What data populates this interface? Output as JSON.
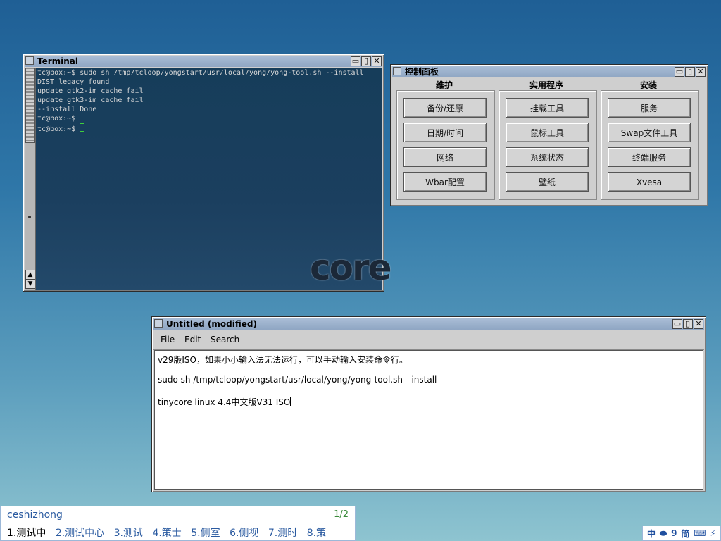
{
  "terminal": {
    "title": "Terminal",
    "lines": [
      "tc@box:~$ sudo sh /tmp/tcloop/yongstart/usr/local/yong/yong-tool.sh --install",
      "DIST legacy found",
      "update gtk2-im cache fail",
      "update gtk3-im cache fail",
      "--install Done",
      "tc@box:~$",
      "tc@box:~$ "
    ]
  },
  "cpanel": {
    "title": "控制面板",
    "columns": [
      {
        "heading": "维护",
        "buttons": [
          "备份/还原",
          "日期/时间",
          "网络",
          "Wbar配置"
        ]
      },
      {
        "heading": "实用程序",
        "buttons": [
          "挂载工具",
          "鼠标工具",
          "系统状态",
          "壁纸"
        ]
      },
      {
        "heading": "安装",
        "buttons": [
          "服务",
          "Swap文件工具",
          "终端服务",
          "Xvesa"
        ]
      }
    ]
  },
  "logo": {
    "text": "core"
  },
  "editor": {
    "title": "Untitled  (modified)",
    "menu": {
      "file": "File",
      "edit": "Edit",
      "search": "Search"
    },
    "lines": [
      "v29版ISO，如果小小输入法无法运行，可以手动输入安装命令行。",
      "sudo sh /tmp/tcloop/yongstart/usr/local/yong/yong-tool.sh --install",
      "tinycore linux 4.4中文版V31 ISO"
    ]
  },
  "ime": {
    "input": "ceshizhong",
    "page": "1/2",
    "candidates": [
      "1.测试中",
      "2.测试中心",
      "3.测试",
      "4.策士",
      "5.侧室",
      "6.侧视",
      "7.测时",
      "8.策"
    ]
  },
  "tray": {
    "items": [
      "中",
      "⬬",
      "9",
      "简",
      "⌨",
      "⚡"
    ]
  }
}
